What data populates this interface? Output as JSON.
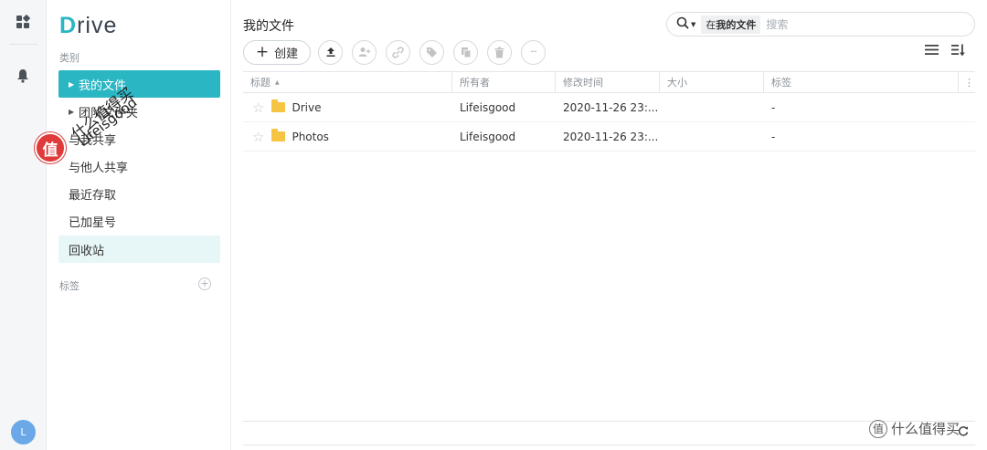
{
  "app": {
    "logo_first": "D",
    "logo_rest": "rive"
  },
  "rail": {
    "avatar_letter": "L"
  },
  "sidebar": {
    "section_label": "类别",
    "items": [
      {
        "label": "我的文件",
        "has_caret": true
      },
      {
        "label": "团队文件夹",
        "has_caret": true
      },
      {
        "label": "与我共享",
        "has_caret": false
      },
      {
        "label": "与他人共享",
        "has_caret": false
      },
      {
        "label": "最近存取",
        "has_caret": false
      },
      {
        "label": "已加星号",
        "has_caret": false
      },
      {
        "label": "回收站",
        "has_caret": false
      }
    ],
    "tags_label": "标签",
    "add_tag_symbol": "+"
  },
  "watermark": {
    "badge": "值",
    "line1": "什么值得买",
    "line2": "Lifeisgood"
  },
  "main": {
    "title": "我的文件",
    "search": {
      "scope_prefix": "在",
      "scope_bold": "我的文件",
      "placeholder": "搜索"
    },
    "toolbar": {
      "create_label": "创建",
      "create_symbol": "+",
      "more_symbol": "···"
    },
    "table": {
      "columns": [
        "标题",
        "所有者",
        "修改时间",
        "大小",
        "标签"
      ],
      "sort_indicator": "▲",
      "column_menu": "⋮",
      "rows": [
        {
          "title": "Drive",
          "owner": "Lifeisgood",
          "modified": "2020-11-26 23:...",
          "size": "",
          "tags": "-"
        },
        {
          "title": "Photos",
          "owner": "Lifeisgood",
          "modified": "2020-11-26 23:...",
          "size": "",
          "tags": "-"
        }
      ]
    },
    "footer_watermark": {
      "badge": "值",
      "text": "什么值得买"
    }
  },
  "colors": {
    "accent": "#2bb6c4",
    "hover": "#e7f6f7",
    "folder": "#f5c443",
    "watermark_red": "#e03a3a"
  }
}
